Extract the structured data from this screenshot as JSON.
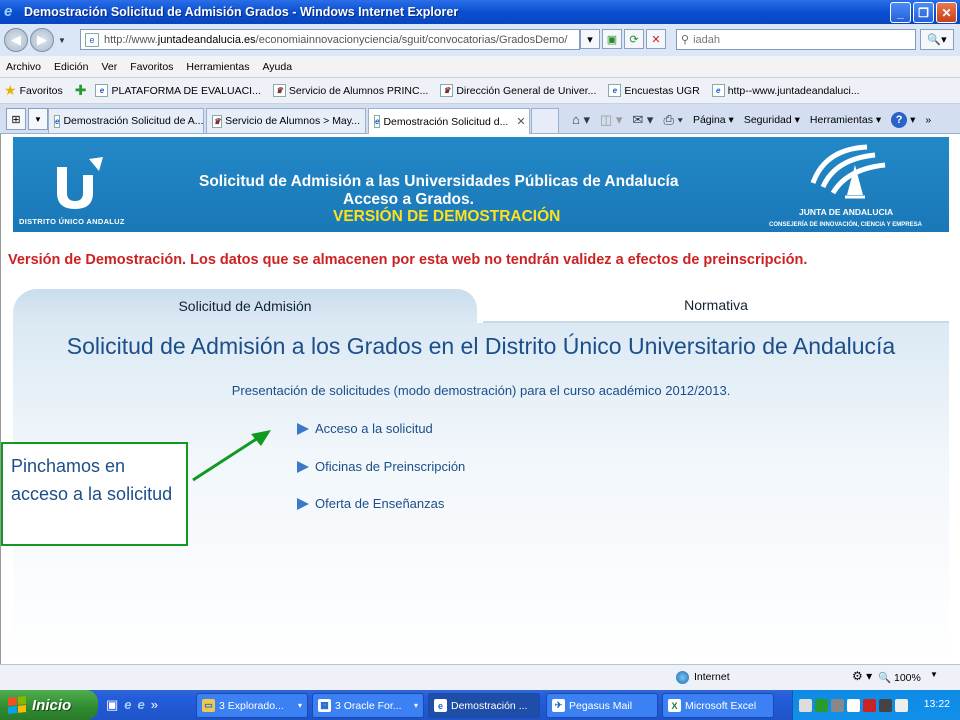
{
  "window": {
    "title": "Demostración Solicitud de Admisión Grados - Windows Internet Explorer"
  },
  "addressbar": {
    "url_prefix": "http://www.",
    "url_domain": "juntadeandalucia.es",
    "url_path": "/economiainnovacionyciencia/sguit/convocatorias/GradosDemo/",
    "search_value": "iadah"
  },
  "menu": [
    "Archivo",
    "Edición",
    "Ver",
    "Favoritos",
    "Herramientas",
    "Ayuda"
  ],
  "favorites": {
    "label": "Favoritos",
    "items": [
      "PLATAFORMA DE EVALUACI...",
      "Servicio de Alumnos PRINC...",
      "Dirección General de Univer...",
      "Encuestas UGR",
      "http--www.juntadeandaluci..."
    ]
  },
  "tabs": [
    "Demostración Solicitud de A...",
    "Servicio de Alumnos > May...",
    "Demostración Solicitud d..."
  ],
  "commandbar": {
    "page": "Página",
    "security": "Seguridad",
    "tools": "Herramientas"
  },
  "banner": {
    "distrito": "DISTRITO ÚNICO ANDALUZ",
    "line1": "Solicitud de Admisión a las Universidades Públicas de Andalucía",
    "line2": "Acceso a Grados.",
    "line3": "VERSIÓN DE DEMOSTRACIÓN",
    "junta": "JUNTA DE ANDALUCIA",
    "consejeria": "CONSEJERÍA DE INNOVACIÓN, CIENCIA Y EMPRESA"
  },
  "warning": "Versión de Demostración. Los datos que se almacenen por esta web no tendrán validez a efectos de preinscripción.",
  "content_tabs": {
    "solicitud": "Solicitud de Admisión",
    "normativa": "Normativa"
  },
  "panel": {
    "heading": "Solicitud de Admisión a los Grados en el Distrito Único Universitario de Andalucía",
    "subtitle": "Presentación de solicitudes (modo demostración) para el curso académico 2012/2013.",
    "links": [
      "Acceso a la solicitud",
      "Oficinas de Preinscripción",
      "Oferta de Enseñanzas"
    ]
  },
  "callout": {
    "text": "Pinchamos en acceso a la solicitud",
    "border_color": "#119922"
  },
  "statusbar": {
    "zone": "Internet",
    "zoom": "100%"
  },
  "taskbar": {
    "start": "Inicio",
    "tasks": [
      "3 Explorado...",
      "3 Oracle For...",
      "Demostración ...",
      "Pegasus Mail",
      "Microsoft Excel"
    ],
    "clock": "13:22"
  },
  "colors": {
    "banner_blue": "#2388c7",
    "heading_blue": "#1c4e8a",
    "warning_red": "#cc2222",
    "highlight_yellow": "#ffe11a"
  }
}
